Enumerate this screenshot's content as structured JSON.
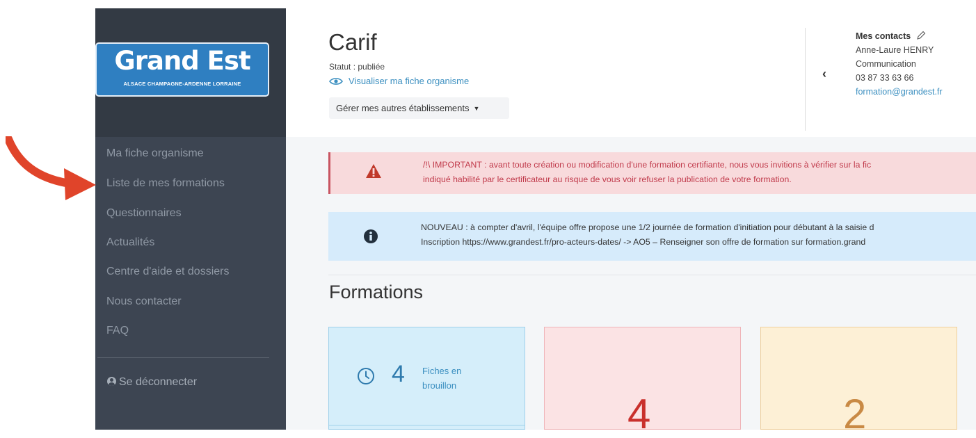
{
  "logo": {
    "main": "Grand Est",
    "sub": "ALSACE CHAMPAGNE-ARDENNE LORRAINE"
  },
  "sidebar": {
    "items": [
      {
        "label": "Ma fiche organisme"
      },
      {
        "label": "Liste de mes formations"
      },
      {
        "label": "Questionnaires"
      },
      {
        "label": "Actualités"
      },
      {
        "label": "Centre d'aide et dossiers"
      },
      {
        "label": "Nous contacter"
      },
      {
        "label": "FAQ"
      }
    ],
    "logout": "Se déconnecter"
  },
  "header": {
    "title": "Carif",
    "status": "Statut : publiée",
    "view_link": "Visualiser ma fiche organisme",
    "manage_button": "Gérer mes autres établissements"
  },
  "contacts": {
    "title": "Mes contacts",
    "name": "Anne-Laure HENRY",
    "role": "Communication",
    "phone": "03 87 33 63 66",
    "email": "formation@grandest.fr"
  },
  "alerts": {
    "warning": {
      "line1": "/!\\ IMPORTANT : avant toute création ou modification d'une formation certifiante, nous vous invitions à vérifier sur la fic",
      "line2": "indiqué habilité par le certificateur au risque de vous voir refuser la publication de votre formation."
    },
    "info": {
      "line1": "NOUVEAU : à compter d'avril, l'équipe offre propose une 1/2 journée de formation d'initiation pour débutant à la saisie d",
      "line2": "Inscription https://www.grandest.fr/pro-acteurs-dates/ -> AO5 – Renseigner son offre de formation sur formation.grand"
    }
  },
  "formations": {
    "heading": "Formations",
    "cards": [
      {
        "value": "4",
        "label_1": "Fiches en",
        "label_2": "brouillon"
      },
      {
        "value": "4"
      },
      {
        "value": "2"
      }
    ]
  },
  "colors": {
    "sidebar_bg": "#3d4552",
    "accent": "#3b8fc0",
    "danger": "#c9302c",
    "warning_number": "#c98a45",
    "arrow": "#e0442a"
  }
}
